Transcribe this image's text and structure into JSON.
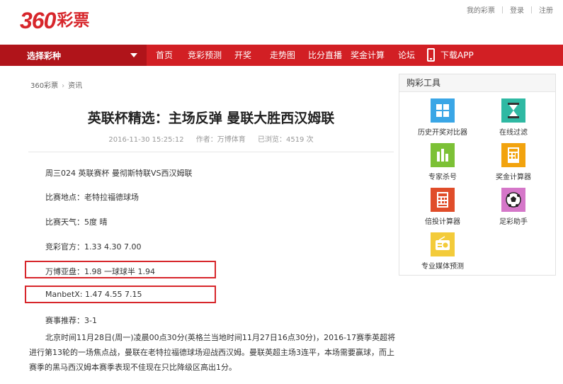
{
  "header": {
    "logo_number": "360",
    "logo_text": "彩票",
    "links": [
      "我的彩票",
      "登录",
      "注册"
    ]
  },
  "nav": {
    "select_label": "选择彩种",
    "items": [
      "首页",
      "竞彩预测",
      "开奖",
      "走势图",
      "比分直播",
      "奖金计算",
      "论坛"
    ],
    "app_label": "下载APP"
  },
  "breadcrumb": [
    "360彩票",
    "资讯"
  ],
  "article": {
    "title": "英联杯精选：主场反弹 曼联大胜西汉姆联",
    "date": "2016-11-30 15:25:12",
    "author": "作者：万博体育",
    "views": "已浏览：4519 次",
    "lines": [
      "周三024 英联赛杯 曼彻斯特联VS西汉姆联",
      "比赛地点：老特拉福德球场",
      "比赛天气：5度 晴",
      "竞彩官方：1.33 4.30 7.00",
      "万博亚盘：1.98 一球球半 1.94",
      "ManbetX: 1.47 4.55 7.15",
      "赛事推荐：3-1"
    ],
    "body": "北京时间11月28日(周一)凌晨00点30分(英格兰当地时间11月27日16点30分)，2016-17赛季英超将进行第13轮的一场焦点战，曼联在老特拉福德球场迎战西汉姆。曼联英超主场3连平，本场需要赢球，而上赛季的黑马西汉姆本赛季表现不佳现在只比降级区高出1分。"
  },
  "tools": {
    "title": "购彩工具",
    "items": [
      {
        "label": "历史开奖对比器",
        "icon": "grid-icon",
        "color": "#3aa6e6"
      },
      {
        "label": "在线过滤",
        "icon": "hourglass-icon",
        "color": "#2fb9a3"
      },
      {
        "label": "专家杀号",
        "icon": "bar-chart-icon",
        "color": "#7cc136"
      },
      {
        "label": "奖金计算器",
        "icon": "calculator-icon",
        "color": "#f2a30e"
      },
      {
        "label": "倍投计算器",
        "icon": "calculator-icon",
        "color": "#e04d2a"
      },
      {
        "label": "足彩助手",
        "icon": "soccer-ball-icon",
        "color": "#d577c9"
      },
      {
        "label": "专业媒体预测",
        "icon": "radio-icon",
        "color": "#f3cb3a"
      }
    ]
  }
}
